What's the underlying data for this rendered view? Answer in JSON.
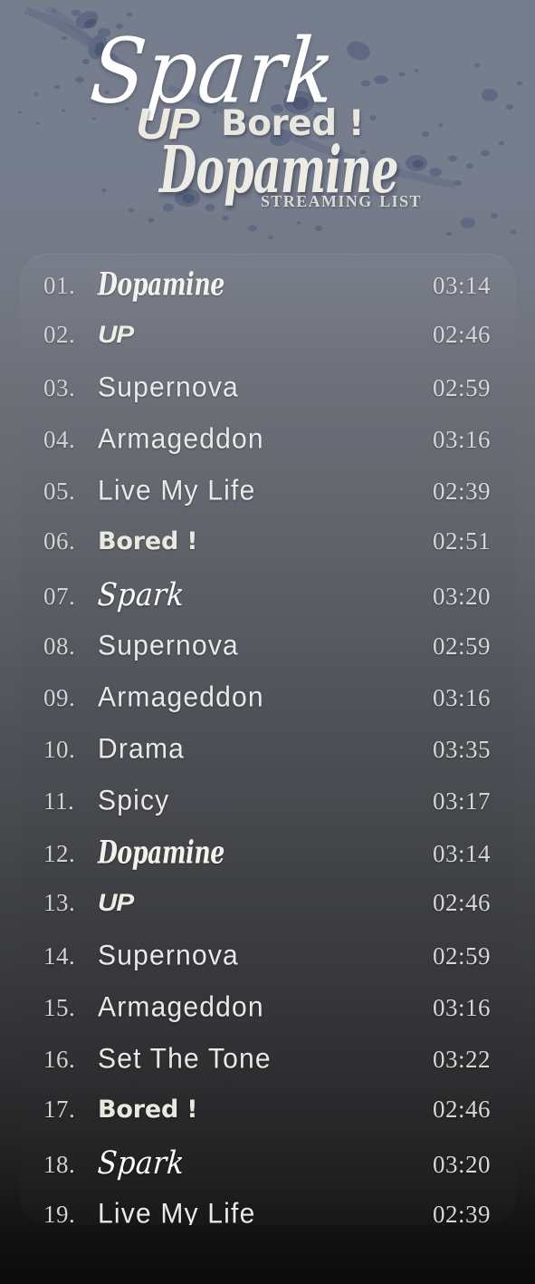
{
  "header": {
    "word_spark": "Spark",
    "word_up": "UP",
    "word_bored": "Bored !",
    "word_dopamine": "Dopamine",
    "word_streaming": "Streaming List"
  },
  "colors": {
    "background_top": "#767d8d",
    "background_bottom": "#0b0b0c",
    "splatter": "#525e7f",
    "card_top": "#74777f",
    "card_mid": "#55585f",
    "card_bottom": "#282828",
    "text": "#e7e8e6",
    "text_accent": "#ffffff"
  },
  "tracklist": {
    "tracks": [
      {
        "num": "01.",
        "title": "Dopamine",
        "time": "03:14",
        "style": "style-serif-italic"
      },
      {
        "num": "02.",
        "title": "UP",
        "time": "02:46",
        "style": "style-bold-italic"
      },
      {
        "num": "03.",
        "title": "Supernova",
        "time": "02:59",
        "style": "style-thin"
      },
      {
        "num": "04.",
        "title": "Armageddon",
        "time": "03:16",
        "style": "style-thin"
      },
      {
        "num": "05.",
        "title": "Live My Life",
        "time": "02:39",
        "style": "style-thin"
      },
      {
        "num": "06.",
        "title": "Bored !",
        "time": "02:51",
        "style": "style-slab-bold"
      },
      {
        "num": "07.",
        "title": "Spark",
        "time": "03:20",
        "style": "style-script"
      },
      {
        "num": "08.",
        "title": "Supernova",
        "time": "02:59",
        "style": "style-thin"
      },
      {
        "num": "09.",
        "title": "Armageddon",
        "time": "03:16",
        "style": "style-thin"
      },
      {
        "num": "10.",
        "title": "Drama",
        "time": "03:35",
        "style": "style-thin"
      },
      {
        "num": "11.",
        "title": "Spicy",
        "time": "03:17",
        "style": "style-thin"
      },
      {
        "num": "12.",
        "title": "Dopamine",
        "time": "03:14",
        "style": "style-serif-italic"
      },
      {
        "num": "13.",
        "title": "UP",
        "time": "02:46",
        "style": "style-bold-italic"
      },
      {
        "num": "14.",
        "title": "Supernova",
        "time": "02:59",
        "style": "style-thin"
      },
      {
        "num": "15.",
        "title": "Armageddon",
        "time": "03:16",
        "style": "style-thin"
      },
      {
        "num": "16.",
        "title": "Set The Tone",
        "time": "03:22",
        "style": "style-thin"
      },
      {
        "num": "17.",
        "title": "Bored !",
        "time": "02:46",
        "style": "style-slab-bold"
      },
      {
        "num": "18.",
        "title": "Spark",
        "time": "03:20",
        "style": "style-script"
      },
      {
        "num": "19.",
        "title": "Live My Life",
        "time": "02:39",
        "style": "style-thin"
      }
    ]
  }
}
